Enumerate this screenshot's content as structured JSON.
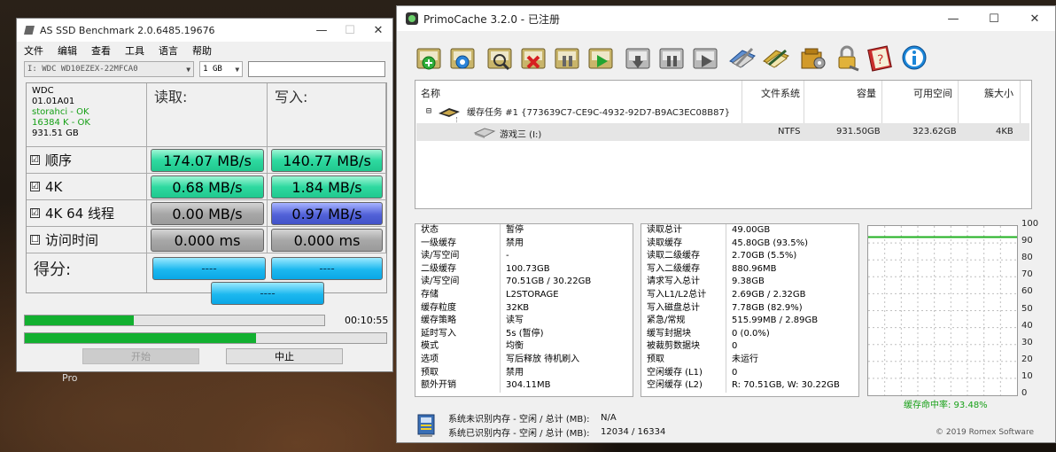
{
  "desktop": {
    "label": "Pro"
  },
  "asssd": {
    "title": "AS SSD Benchmark 2.0.6485.19676",
    "menu": [
      "文件",
      "编辑",
      "查看",
      "工具",
      "语言",
      "帮助"
    ],
    "drive_select": "I: WDC WD10EZEX-22MFCA0",
    "size_select": "1 GB",
    "device": {
      "model": "WDC",
      "firmware": "01.01A01",
      "driver": "storahci - OK",
      "alignment": "16384 K - OK",
      "capacity": "931.51 GB"
    },
    "read_header": "读取:",
    "write_header": "写入:",
    "rows": [
      {
        "label": "顺序",
        "check": "☑",
        "read": "174.07 MB/s",
        "write": "140.77 MB/s"
      },
      {
        "label": "4K",
        "check": "☑",
        "read": "0.68 MB/s",
        "write": "1.84 MB/s"
      },
      {
        "label": "4K 64 线程",
        "check": "☑",
        "read": "0.00 MB/s",
        "write": "0.97 MB/s"
      },
      {
        "label": "访问时间",
        "check": "☐",
        "read": "0.000 ms",
        "write": "0.000 ms"
      }
    ],
    "score_label": "得分:",
    "score_read": "----",
    "score_write": "----",
    "score_total": "----",
    "elapsed": "00:10:55",
    "progress1": 0.364,
    "progress2": 0.64,
    "start_button": "开始",
    "stop_button": "中止"
  },
  "primo": {
    "title": "PrimoCache 3.2.0 - 已注册",
    "toolbar": [
      "new-cache-icon",
      "cache-settings-icon",
      "statistics-icon",
      "delete-cache-icon",
      "pause-icon",
      "resume-icon",
      "flush-icon",
      "suspend-icon",
      "resume-cache-icon",
      "options-icon",
      "license-icon",
      "tools-icon",
      "lock-icon",
      "help-icon",
      "about-icon"
    ],
    "drive_columns": [
      "名称",
      "文件系统",
      "容量",
      "可用空间",
      "簇大小"
    ],
    "task": "缓存任务 #1 {773639C7-CE9C-4932-92D7-B9AC3EC08B87}",
    "volume": {
      "name": "游戏三 (I:)",
      "fs": "NTFS",
      "capacity": "931.50GB",
      "free": "323.62GB",
      "cluster": "4KB"
    },
    "stats_left": [
      {
        "k": "状态",
        "v": "暂停"
      },
      {
        "k": "一级缓存",
        "v": "禁用"
      },
      {
        "k": "  读/写空间",
        "v": "-"
      },
      {
        "k": "二级缓存",
        "v": "100.73GB"
      },
      {
        "k": "  读/写空间",
        "v": "70.51GB / 30.22GB"
      },
      {
        "k": "  存储",
        "v": "L2STORAGE"
      },
      {
        "k": "缓存粒度",
        "v": "32KB"
      },
      {
        "k": "缓存策略",
        "v": "读写"
      },
      {
        "k": "延时写入",
        "v": "5s (暂停)"
      },
      {
        "k": "  模式",
        "v": "均衡"
      },
      {
        "k": "  选项",
        "v": "写后释放 待机刷入"
      },
      {
        "k": "预取",
        "v": "禁用"
      },
      {
        "k": "额外开销",
        "v": "304.11MB"
      }
    ],
    "stats_right": [
      {
        "k": "读取总计",
        "v": "49.00GB"
      },
      {
        "k": "读取缓存",
        "v": "45.80GB (93.5%)"
      },
      {
        "k": "读取二级缓存",
        "v": "2.70GB (5.5%)"
      },
      {
        "k": "写入二级缓存",
        "v": "880.96MB"
      },
      {
        "k": "请求写入总计",
        "v": "9.38GB"
      },
      {
        "k": "写入L1/L2总计",
        "v": "2.69GB / 2.32GB"
      },
      {
        "k": "写入磁盘总计",
        "v": "7.78GB (82.9%)"
      },
      {
        "k": "  紧急/常规",
        "v": "515.99MB / 2.89GB"
      },
      {
        "k": "缓写封据块",
        "v": "0 (0.0%)"
      },
      {
        "k": "被裁剪数据块",
        "v": "0"
      },
      {
        "k": "预取",
        "v": "未运行"
      },
      {
        "k": "空闲缓存 (L1)",
        "v": "0"
      },
      {
        "k": "空闲缓存 (L2)",
        "v": "R: 70.51GB, W: 30.22GB"
      }
    ],
    "graph_y_ticks": [
      "100",
      "90",
      "80",
      "70",
      "60",
      "50",
      "40",
      "30",
      "20",
      "10",
      "0"
    ],
    "hit_rate_value": 93.48,
    "hit_rate_label": "缓存命中率: 93.48%",
    "mem_unrecognized_label": "系统未识别内存 - 空闲 / 总计 (MB):",
    "mem_unrecognized_value": "N/A",
    "mem_recognized_label": "系统已识别内存 - 空闲 / 总计 (MB):",
    "mem_recognized_value": "12034 / 16334",
    "copyright": "© 2019 Romex Software"
  }
}
